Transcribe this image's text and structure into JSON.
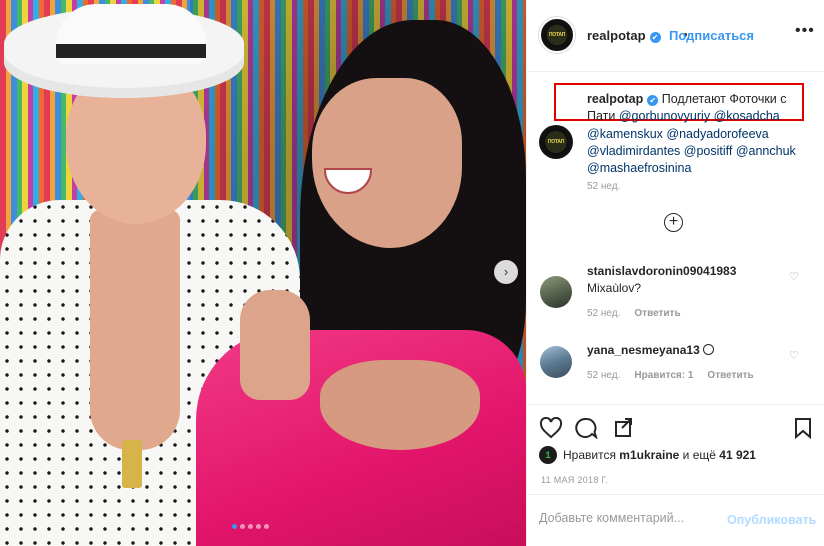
{
  "header": {
    "avatar_text": "ПОТАП",
    "username": "realpotap",
    "verified_mark": "✔",
    "bullet": "•",
    "follow_label": "Подписаться",
    "more_label": "•••"
  },
  "photo": {
    "next_glyph": "›",
    "slide_count": 5,
    "active_slide": 1,
    "accent_color": "#3897f0"
  },
  "caption": {
    "username": "realpotap",
    "verified_mark": "✔",
    "text_start": "Подлетают Фоточки с Пати",
    "mentions": [
      "@gorbunovyuriy",
      "@kosadcha",
      "@kamenskux",
      "@nadyadorofeeva",
      "@vladimirdantes",
      "@positiff",
      "@annchuk",
      "@mashaefrosinina"
    ],
    "time": "52 нед.",
    "highlight_color": "#e00000"
  },
  "load_more_glyph": "+",
  "comments": [
    {
      "username": "stanislavdoronin09041983",
      "text": "Mixaùlov?",
      "time": "52 нед.",
      "reply_label": "Ответить",
      "heart": "♡"
    },
    {
      "username": "yana_nesmeyana13",
      "text": "",
      "time": "52 нед.",
      "likes_label": "Нравится: 1",
      "reply_label": "Ответить",
      "heart": "♡"
    }
  ],
  "actions": {
    "icons": [
      "heart-icon",
      "comment-icon",
      "share-icon",
      "bookmark-icon"
    ]
  },
  "likes": {
    "avatar_text": "1",
    "prefix": "Нравится",
    "user": "m1ukraine",
    "suffix": "и ещё",
    "count": "41 921"
  },
  "date": "11 МАЯ 2018 Г.",
  "comment_box": {
    "placeholder": "Добавьте комментарий...",
    "post_label": "Опубликовать"
  }
}
